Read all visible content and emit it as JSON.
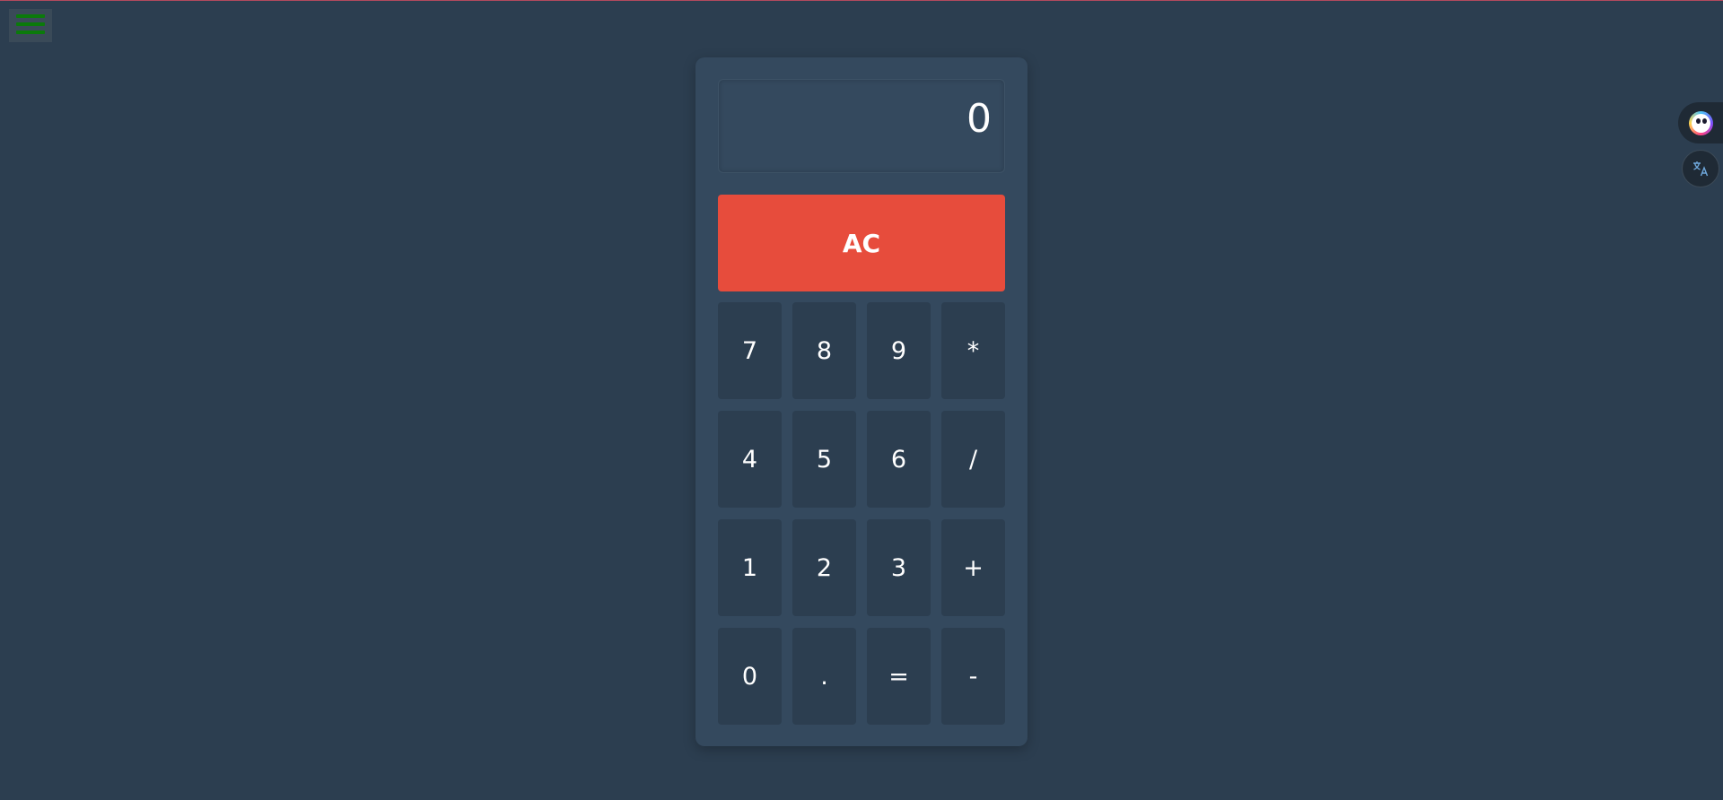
{
  "display": {
    "value": "0"
  },
  "clear_label": "AC",
  "keys": [
    "7",
    "8",
    "9",
    "*",
    "4",
    "5",
    "6",
    "/",
    "1",
    "2",
    "3",
    "+",
    "0",
    ".",
    "=",
    "-"
  ],
  "colors": {
    "background": "#2c3e50",
    "calculator": "#34495e",
    "clear_button": "#e74c3c",
    "menu_bars": "#0b7a0b"
  },
  "icons": {
    "menu": "hamburger-menu-icon",
    "assistant": "assistant-icon",
    "translate": "translate-icon"
  }
}
